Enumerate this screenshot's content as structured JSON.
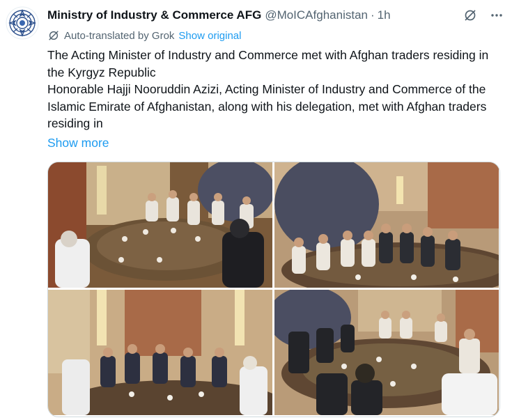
{
  "post": {
    "author_name": "Ministry of Industry & Commerce AFG",
    "handle": "@MoICAfghanistan",
    "separator": "·",
    "time": "1h",
    "translated_label": "Auto-translated by Grok",
    "show_original": "Show original",
    "paragraphs": [
      "The Acting Minister of Industry and Commerce met with Afghan traders residing in the Kyrgyz Republic",
      "Honorable Hajji Nooruddin Azizi, Acting Minister of Industry and Commerce of the Islamic Emirate of Afghanistan, along with his delegation, met with Afghan traders residing in"
    ],
    "show_more": "Show more"
  },
  "icons": {
    "translate": "translate-icon",
    "grok": "grok-icon",
    "more": "more-icon",
    "logo": "ministry-logo"
  },
  "colors": {
    "link": "#1d9bf0",
    "secondary": "#536471",
    "text": "#0f1419"
  }
}
